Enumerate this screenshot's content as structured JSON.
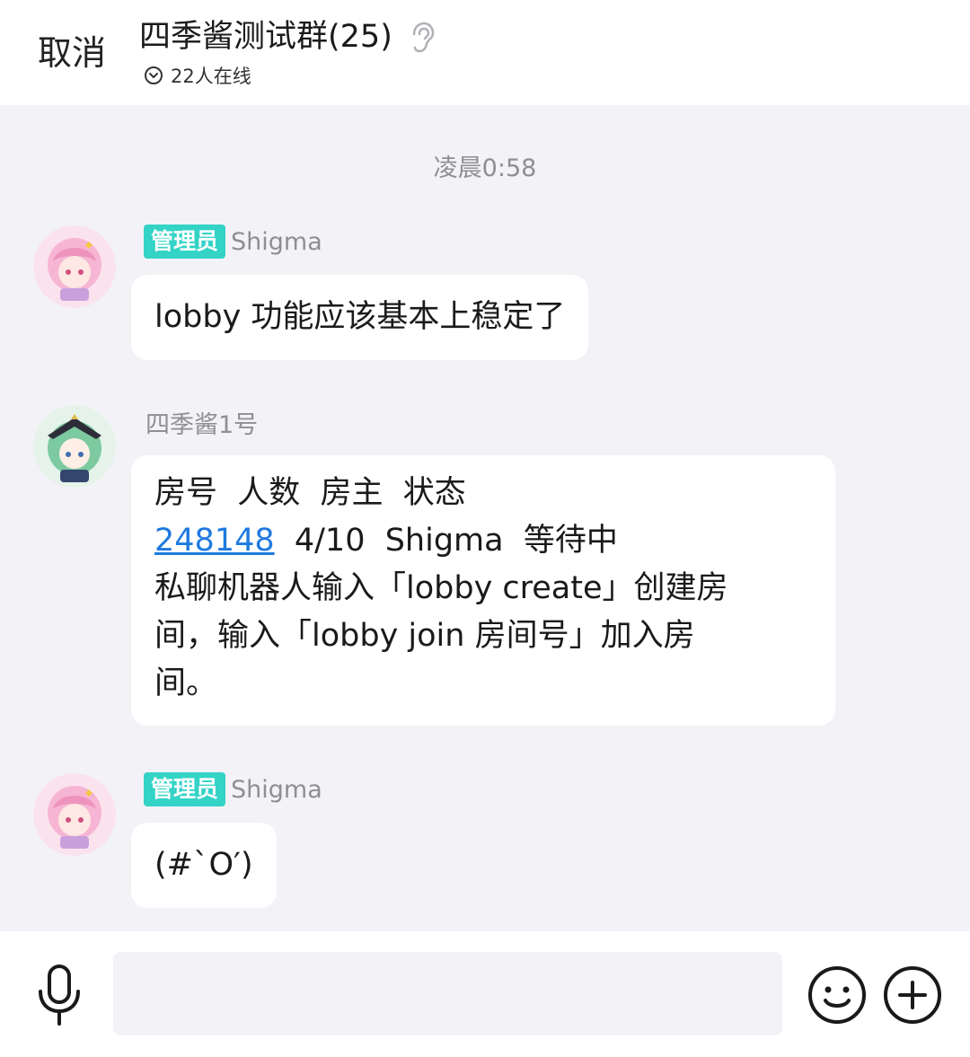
{
  "header": {
    "cancel_label": "取消",
    "title": "四季酱测试群(25)",
    "online_status": "22人在线"
  },
  "chat": {
    "timestamp": "凌晨0:58",
    "messages": [
      {
        "badge": "管理员",
        "sender": "Shigma",
        "avatar": "pink-hair-avatar",
        "lines": [
          "lobby 功能应该基本上稳定了"
        ]
      },
      {
        "badge": "",
        "sender": "四季酱1号",
        "avatar": "green-hair-avatar",
        "lines": [
          "房号  人数  房主  状态",
          "248148",
          "  4/10  Shigma  等待中",
          "私聊机器人输入「lobby create」创建房",
          "间，输入「lobby join 房间号」加入房",
          "间。"
        ],
        "room_id": "248148"
      },
      {
        "badge": "管理员",
        "sender": "Shigma",
        "avatar": "pink-hair-avatar",
        "lines": [
          "(#`O′)"
        ]
      }
    ]
  },
  "input_bar": {
    "value": "",
    "icons": [
      "microphone-icon",
      "emoji-icon",
      "plus-icon"
    ]
  },
  "colors": {
    "accent": "#33d3c6",
    "link": "#1f7ae0",
    "background": "#f3f2f7"
  }
}
